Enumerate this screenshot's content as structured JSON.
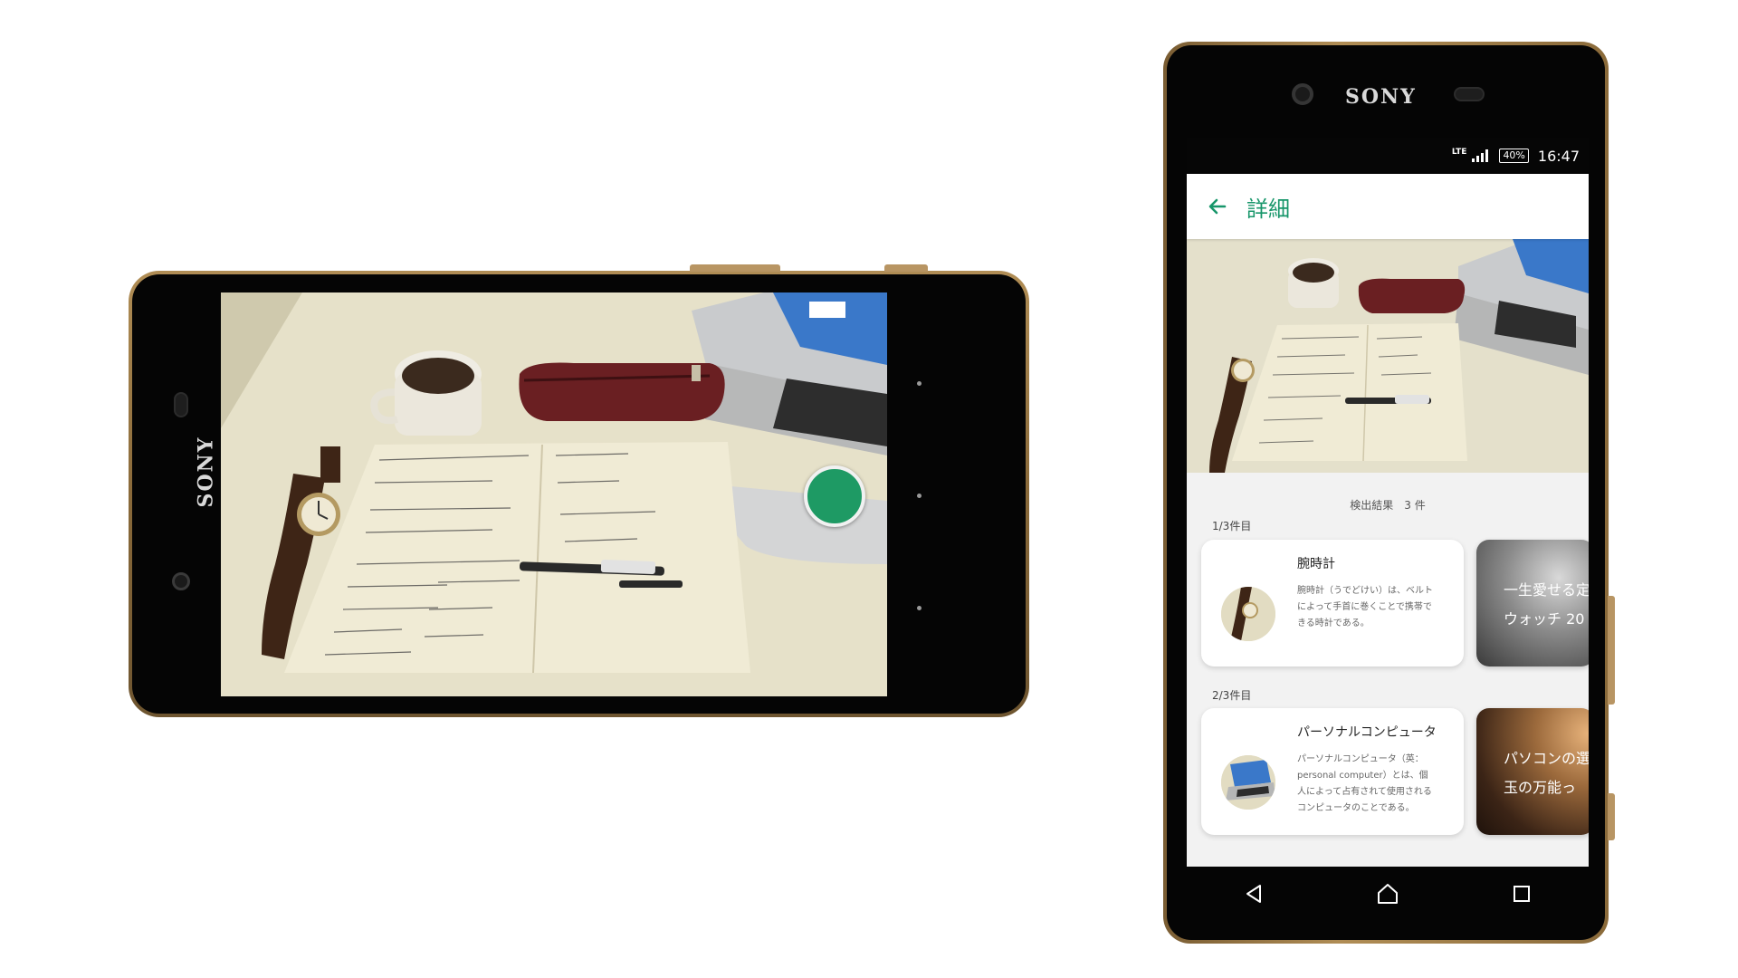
{
  "landscape_phone": {
    "brand": "SONY"
  },
  "portrait_phone": {
    "brand": "SONY",
    "status_bar": {
      "network": "LTE",
      "battery": "40%",
      "time": "16:47"
    },
    "app_bar": {
      "title": "詳細"
    },
    "results": {
      "count_text": "検出結果　3 件",
      "items": [
        {
          "index_label": "1/3件目",
          "title": "腕時計",
          "description": "腕時計（うでどけい）は、ベルトによって手首に巻くことで携帯できる時計である。",
          "side_card_text_1": "一生愛せる定",
          "side_card_text_2": "ウォッチ 20"
        },
        {
          "index_label": "2/3件目",
          "title": "パーソナルコンピュータ",
          "description": "パーソナルコンピュータ（英：personal computer）とは、個人によって占有されて使用されるコンピュータのことである。",
          "side_card_text_1": "パソコンの選",
          "side_card_text_2": "玉の万能っ"
        }
      ]
    }
  },
  "colors": {
    "accent": "#17966a",
    "shutter": "#1e9a64",
    "frame_gold": "#b08d55"
  },
  "icons": {
    "back": "arrow-left-icon",
    "nav_back": "triangle-back-icon",
    "nav_home": "home-icon",
    "nav_recents": "square-recents-icon"
  }
}
